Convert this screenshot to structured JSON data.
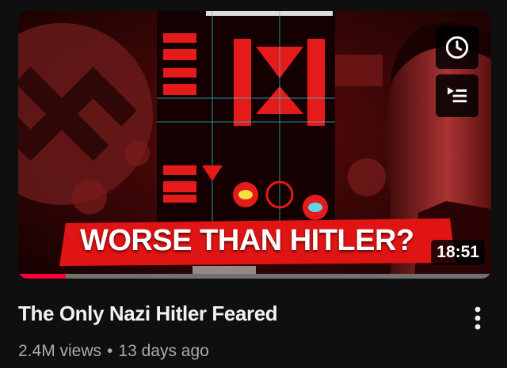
{
  "video": {
    "title": "The Only Nazi Hitler Feared",
    "views": "2.4M views",
    "separator": "•",
    "age": "13 days ago",
    "duration": "18:51",
    "thumbnail_text": "WORSE THAN HITLER?",
    "watch_progress": 0.1
  },
  "icons": {
    "watch_later": "clock-icon",
    "add_to_queue": "queue-icon",
    "more": "kebab-menu-icon"
  },
  "colors": {
    "background": "#0f0f0f",
    "progress": "#ff0033",
    "title": "#f1f1f1",
    "meta": "#aaaaaa"
  }
}
